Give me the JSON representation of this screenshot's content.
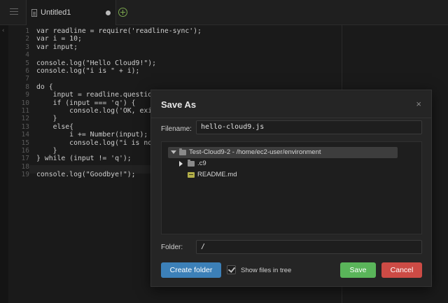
{
  "tabs": [
    {
      "label": "Untitled1",
      "dirty": true
    }
  ],
  "editor": {
    "gutter_mark": "‹",
    "lines": [
      {
        "n": "1",
        "text": "var readline = require('readline-sync');"
      },
      {
        "n": "2",
        "text": "var i = 10;"
      },
      {
        "n": "3",
        "text": "var input;"
      },
      {
        "n": "4",
        "text": ""
      },
      {
        "n": "5",
        "text": "console.log(\"Hello Cloud9!\");"
      },
      {
        "n": "6",
        "text": "console.log(\"i is \" + i);"
      },
      {
        "n": "7",
        "text": ""
      },
      {
        "n": "8",
        "text": "do {"
      },
      {
        "n": "9",
        "text": "    input = readline.question(\"E"
      },
      {
        "n": "10",
        "text": "    if (input === 'q') {"
      },
      {
        "n": "11",
        "text": "        console.log('OK, exiting"
      },
      {
        "n": "12",
        "text": "    }"
      },
      {
        "n": "13",
        "text": "    else{"
      },
      {
        "n": "14",
        "text": "        i += Number(input);"
      },
      {
        "n": "15",
        "text": "        console.log(\"i is now \""
      },
      {
        "n": "16",
        "text": "    }"
      },
      {
        "n": "17",
        "text": "} while (input != 'q');"
      },
      {
        "n": "18",
        "text": ""
      },
      {
        "n": "19",
        "text": "console.log(\"Goodbye!\");"
      }
    ]
  },
  "dialog": {
    "title": "Save As",
    "close": "×",
    "filename_label": "Filename:",
    "filename_value": "hello-cloud9.js",
    "tree": {
      "root": "Test-Cloud9-2 - /home/ec2-user/environment",
      "folder": ".c9",
      "file": "README.md"
    },
    "folder_label": "Folder:",
    "folder_value": "/",
    "create_folder": "Create folder",
    "show_files": "Show files in tree",
    "show_files_checked": true,
    "save": "Save",
    "cancel": "Cancel"
  }
}
